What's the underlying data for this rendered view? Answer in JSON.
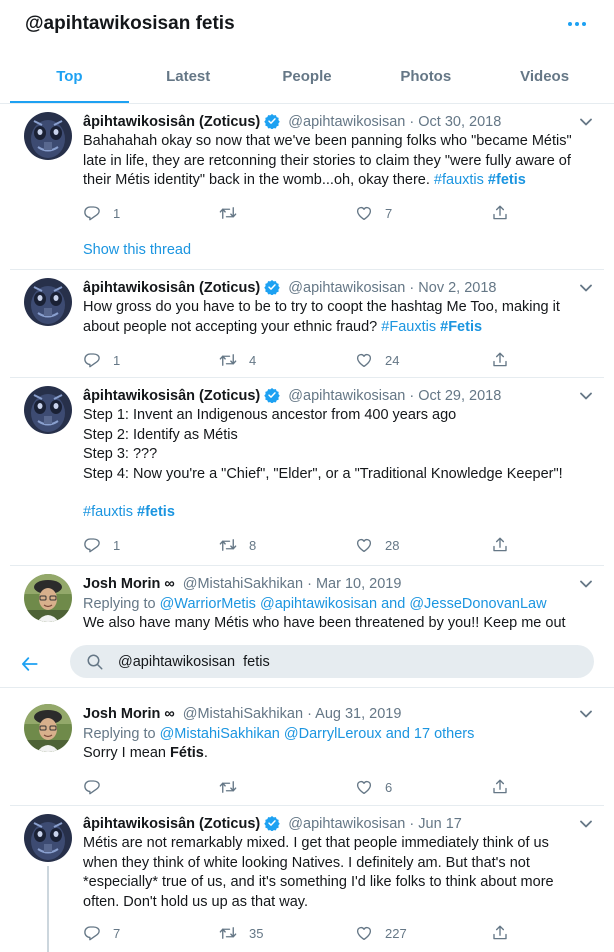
{
  "header": {
    "title": "@apihtawikosisan fetis",
    "tabs": [
      "Top",
      "Latest",
      "People",
      "Photos",
      "Videos"
    ]
  },
  "colors": {
    "accent": "#1da1f2",
    "link": "#1b95e0",
    "muted": "#657786",
    "text": "#14171a",
    "divider": "#e6ecf0"
  },
  "search": {
    "value": "@apihtawikosisan  fetis",
    "icon": "search-icon",
    "back_icon": "arrow-left-icon"
  },
  "tweets": [
    {
      "name": "âpihtawikosisân (Zoticus)",
      "handle": "@apihtawikosisan",
      "sep": "·",
      "date": "Oct 30, 2018",
      "text_main": "Bahahahah okay so now that we've been panning folks who \"became Métis\" late in life, they are retconning their stories to claim they \"were fully aware of their Métis identity\" back in the womb...oh, okay there. ",
      "tags": [
        "#fauxtis",
        "#fetis"
      ],
      "counts": {
        "reply": "1",
        "retweet": "",
        "like": "7"
      },
      "show_thread": "Show this thread"
    },
    {
      "name": "âpihtawikosisân (Zoticus)",
      "handle": "@apihtawikosisan",
      "sep": "·",
      "date": "Nov 2, 2018",
      "text_main": "How gross do you have to be to try to coopt the hashtag Me Too, making it about people not accepting your ethnic fraud? ",
      "tags": [
        "#Fauxtis",
        "#Fetis"
      ],
      "counts": {
        "reply": "1",
        "retweet": "4",
        "like": "24"
      }
    },
    {
      "name": "âpihtawikosisân (Zoticus)",
      "handle": "@apihtawikosisan",
      "sep": "·",
      "date": "Oct 29, 2018",
      "lines": [
        "Step 1: Invent an Indigenous ancestor from 400 years ago",
        "Step 2: Identify as Métis",
        "Step 3: ???",
        "Step 4: Now you're a \"Chief\", \"Elder\", or a \"Traditional Knowledge Keeper\"!"
      ],
      "tags": [
        "#fauxtis",
        "#fetis"
      ],
      "counts": {
        "reply": "1",
        "retweet": "8",
        "like": "28"
      }
    },
    {
      "name": "Josh Morin ∞",
      "handle": "@MistahiSakhikan",
      "sep": "·",
      "date": "Mar 10, 2019",
      "replying_label": "Replying to",
      "replying": [
        "@WarriorMetis",
        "@apihtawikosisan",
        "@JesseDonovanLaw"
      ],
      "replying_and": "and",
      "text_main": "We also have many Métis who have been threatened by you!! Keep me out"
    },
    {
      "name": "Josh Morin ∞",
      "handle": "@MistahiSakhikan",
      "sep": "·",
      "date": "Aug 31, 2019",
      "replying_label": "Replying to",
      "replying": [
        "@MistahiSakhikan",
        "@DarrylLeroux",
        "and 17 others"
      ],
      "text_main": "Sorry I mean ",
      "text_bold": "Fétis",
      "text_end": ".",
      "counts": {
        "reply": "",
        "retweet": "",
        "like": "6"
      }
    },
    {
      "name": "âpihtawikosisân (Zoticus)",
      "handle": "@apihtawikosisan",
      "sep": "·",
      "date": "Jun 17",
      "lines": [
        "Métis are not remarkably mixed. I get that people immediately think of us",
        "when they think of white looking Natives. I definitely am. But that's not",
        "*especially* true of us, and it's something I'd like folks to think about more",
        "often. Don't hold us up as that way."
      ],
      "counts": {
        "reply": "7",
        "retweet": "35",
        "like": "227"
      }
    }
  ]
}
